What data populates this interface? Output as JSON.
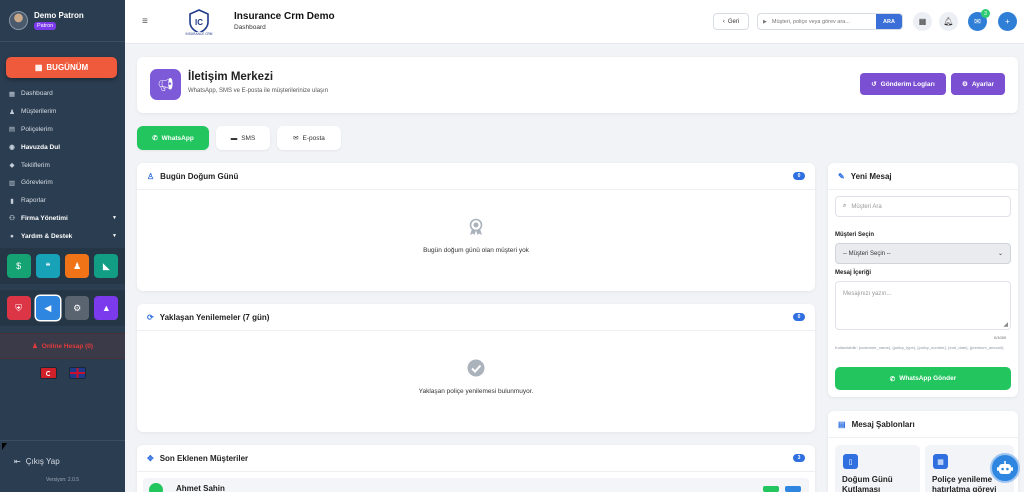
{
  "sidebar": {
    "user_name": "Demo Patron",
    "user_role": "Patron",
    "today_label": "BUGÜNÜM",
    "menu": [
      {
        "label": "Dashboard",
        "icon": "dashboard-icon",
        "bold": false
      },
      {
        "label": "Müşterilerim",
        "icon": "users-icon",
        "bold": false
      },
      {
        "label": "Poliçelerim",
        "icon": "file-icon",
        "bold": false
      },
      {
        "label": "Havuzda Dul",
        "icon": "pool-icon",
        "bold": true
      },
      {
        "label": "Tekliflerim",
        "icon": "tag-icon",
        "bold": false
      },
      {
        "label": "Görevlerim",
        "icon": "calendar-icon",
        "bold": false
      },
      {
        "label": "Raporlar",
        "icon": "chart-icon",
        "bold": false
      },
      {
        "label": "Firma Yönetimi",
        "icon": "sitemap-icon",
        "bold": true,
        "caret": true
      },
      {
        "label": "Yardım & Destek",
        "icon": "help-icon",
        "bold": true,
        "caret": true
      }
    ],
    "quick_row1": [
      {
        "icon": "money-icon",
        "color": "#16a374"
      },
      {
        "icon": "chat-icon",
        "color": "#17a2b8"
      },
      {
        "icon": "user-tie-icon",
        "color": "#f07417"
      },
      {
        "icon": "chart-area-icon",
        "color": "#129d85"
      }
    ],
    "quick_row2": [
      {
        "icon": "shield-icon",
        "color": "#dc3545"
      },
      {
        "icon": "megaphone-icon",
        "color": "#2f86e0"
      },
      {
        "icon": "gear-icon",
        "color": "#5a6470"
      },
      {
        "icon": "graduation-cap-icon",
        "color": "#7c3aed"
      }
    ],
    "online_label": "Online Hesap (0)",
    "logout_label": "Çıkış Yap",
    "version": "Versiyon: 2.0.5"
  },
  "header": {
    "title": "Insurance Crm Demo",
    "subtitle": "Dashboard",
    "back_label": "Geri",
    "search_placeholder": "Müşteri, poliçe veya görev ara...",
    "search_button": "ARA",
    "mail_badge": "3"
  },
  "hero": {
    "title": "İletişim Merkezi",
    "subtitle": "WhatsApp, SMS ve E-posta ile müşterilerinize ulaşın",
    "logs_button": "Gönderim Logları",
    "settings_button": "Ayarlar"
  },
  "tabs": [
    {
      "label": "WhatsApp",
      "icon": "whatsapp-icon",
      "active": true
    },
    {
      "label": "SMS",
      "icon": "sms-icon",
      "active": false
    },
    {
      "label": "E-posta",
      "icon": "envelope-icon",
      "active": false
    }
  ],
  "birthday_card": {
    "title": "Bugün Doğum Günü",
    "count": "0",
    "empty": "Bugün doğum günü olan müşteri yok"
  },
  "renewals_card": {
    "title": "Yaklaşan Yenilemeler (7 gün)",
    "count": "0",
    "empty": "Yaklaşan poliçe yenilemesi bulunmuyor."
  },
  "recent_card": {
    "title": "Son Eklenen Müşteriler",
    "count": "3",
    "first_row": "Ahmet Sahin"
  },
  "new_message": {
    "title": "Yeni Mesaj",
    "search_placeholder": "Müşteri Ara",
    "customer_label": "Müşteri Seçin",
    "customer_select": "-- Müşteri Seçin --",
    "content_label": "Mesaj İçeriği",
    "content_placeholder": "Mesajınızı yazın...",
    "counter": "0/1000",
    "vars_hint": "Kullanılabilir: {customer_name}, {policy_type}, {policy_number}, {end_date}, {premium_amount}",
    "send_button": "WhatsApp Gönder"
  },
  "templates": {
    "title": "Mesaj Şablonları",
    "items": [
      {
        "title": "Doğum Günü Kutlaması"
      },
      {
        "title": "Poliçe yenileme hatırlatma görevi"
      }
    ]
  }
}
